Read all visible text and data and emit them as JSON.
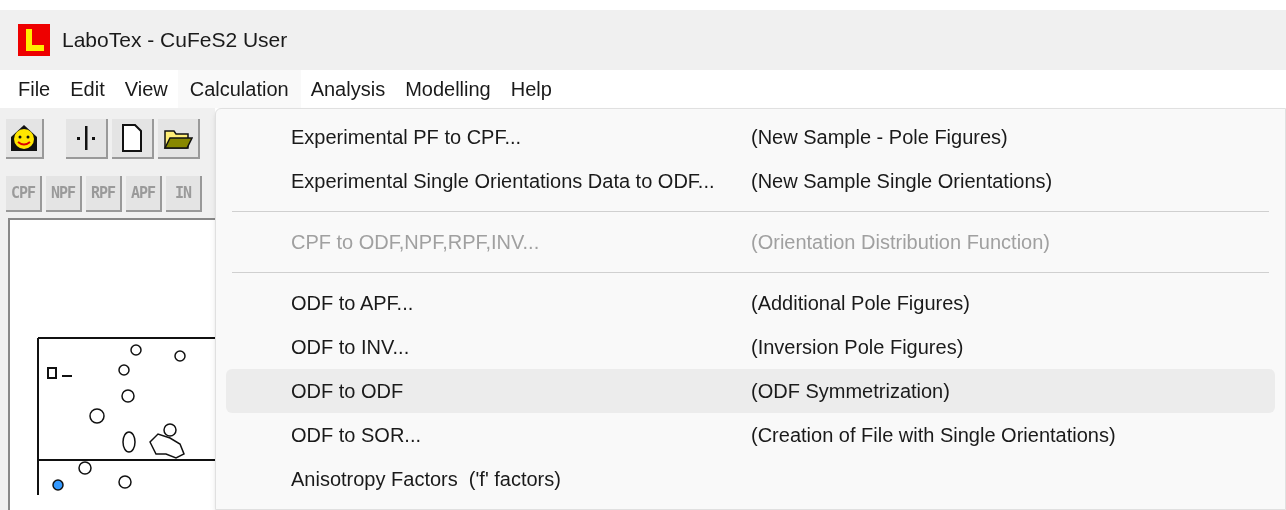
{
  "window": {
    "title": "LaboTex - CuFeS2 User"
  },
  "menubar": [
    {
      "label": "File",
      "selected": false
    },
    {
      "label": "Edit",
      "selected": false
    },
    {
      "label": "View",
      "selected": false
    },
    {
      "label": "Calculation",
      "selected": true
    },
    {
      "label": "Analysis",
      "selected": false
    },
    {
      "label": "Modelling",
      "selected": false
    },
    {
      "label": "Help",
      "selected": false
    }
  ],
  "toolbar_buttons": [
    {
      "label": "CPF"
    },
    {
      "label": "NPF"
    },
    {
      "label": "RPF"
    },
    {
      "label": "APF"
    },
    {
      "label": "IN"
    }
  ],
  "menu": [
    {
      "kind": "item",
      "label": "Experimental PF to CPF...",
      "hint": "(New Sample - Pole Figures)",
      "disabled": false,
      "selected": false
    },
    {
      "kind": "item",
      "label": "Experimental Single Orientations Data to ODF...",
      "hint": "(New Sample Single Orientations)",
      "disabled": false,
      "selected": false
    },
    {
      "kind": "separator"
    },
    {
      "kind": "item",
      "label": "CPF to ODF,NPF,RPF,INV...",
      "hint": "(Orientation Distribution Function)",
      "disabled": true,
      "selected": false
    },
    {
      "kind": "separator"
    },
    {
      "kind": "item",
      "label": "ODF to APF...",
      "hint": "(Additional Pole Figures)",
      "disabled": false,
      "selected": false
    },
    {
      "kind": "item",
      "label": "ODF to INV...",
      "hint": "(Inversion Pole Figures)",
      "disabled": false,
      "selected": false
    },
    {
      "kind": "item",
      "label": "ODF to ODF",
      "hint": "(ODF Symmetrization)",
      "disabled": false,
      "selected": true
    },
    {
      "kind": "item",
      "label": "ODF to SOR...",
      "hint": "(Creation of File with Single Orientations)",
      "disabled": false,
      "selected": false
    },
    {
      "kind": "item",
      "label": "Anisotropy Factors  ('f' factors)",
      "disabled": false,
      "selected": false
    }
  ]
}
